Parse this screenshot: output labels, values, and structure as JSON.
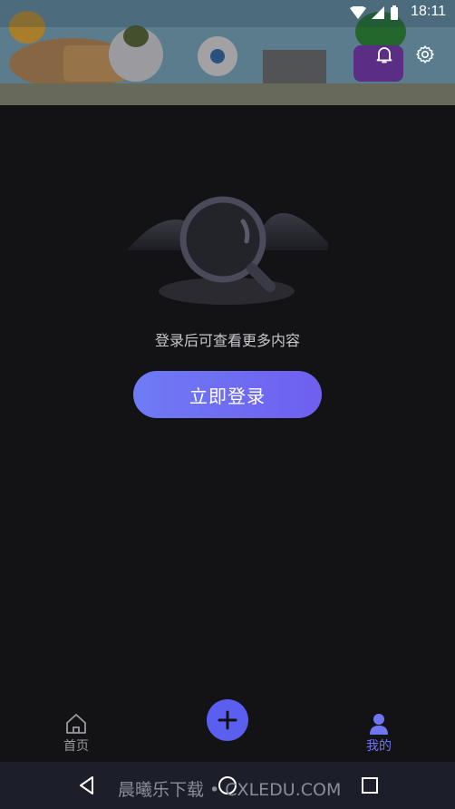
{
  "status_bar": {
    "time": "18:11"
  },
  "empty_state": {
    "message": "登录后可查看更多内容"
  },
  "login": {
    "button_label": "立即登录"
  },
  "tabs": [
    {
      "label": "首页",
      "icon": "home-icon",
      "active": false
    },
    {
      "label": "我的",
      "icon": "user-icon",
      "active": true
    }
  ],
  "fab": {
    "icon": "plus-icon"
  },
  "watermark": {
    "text": "晨曦乐下载 • CXLEDU.COM"
  },
  "colors": {
    "accent": "#6f76f2",
    "background": "#131214",
    "navbar": "#1c1f2a"
  }
}
